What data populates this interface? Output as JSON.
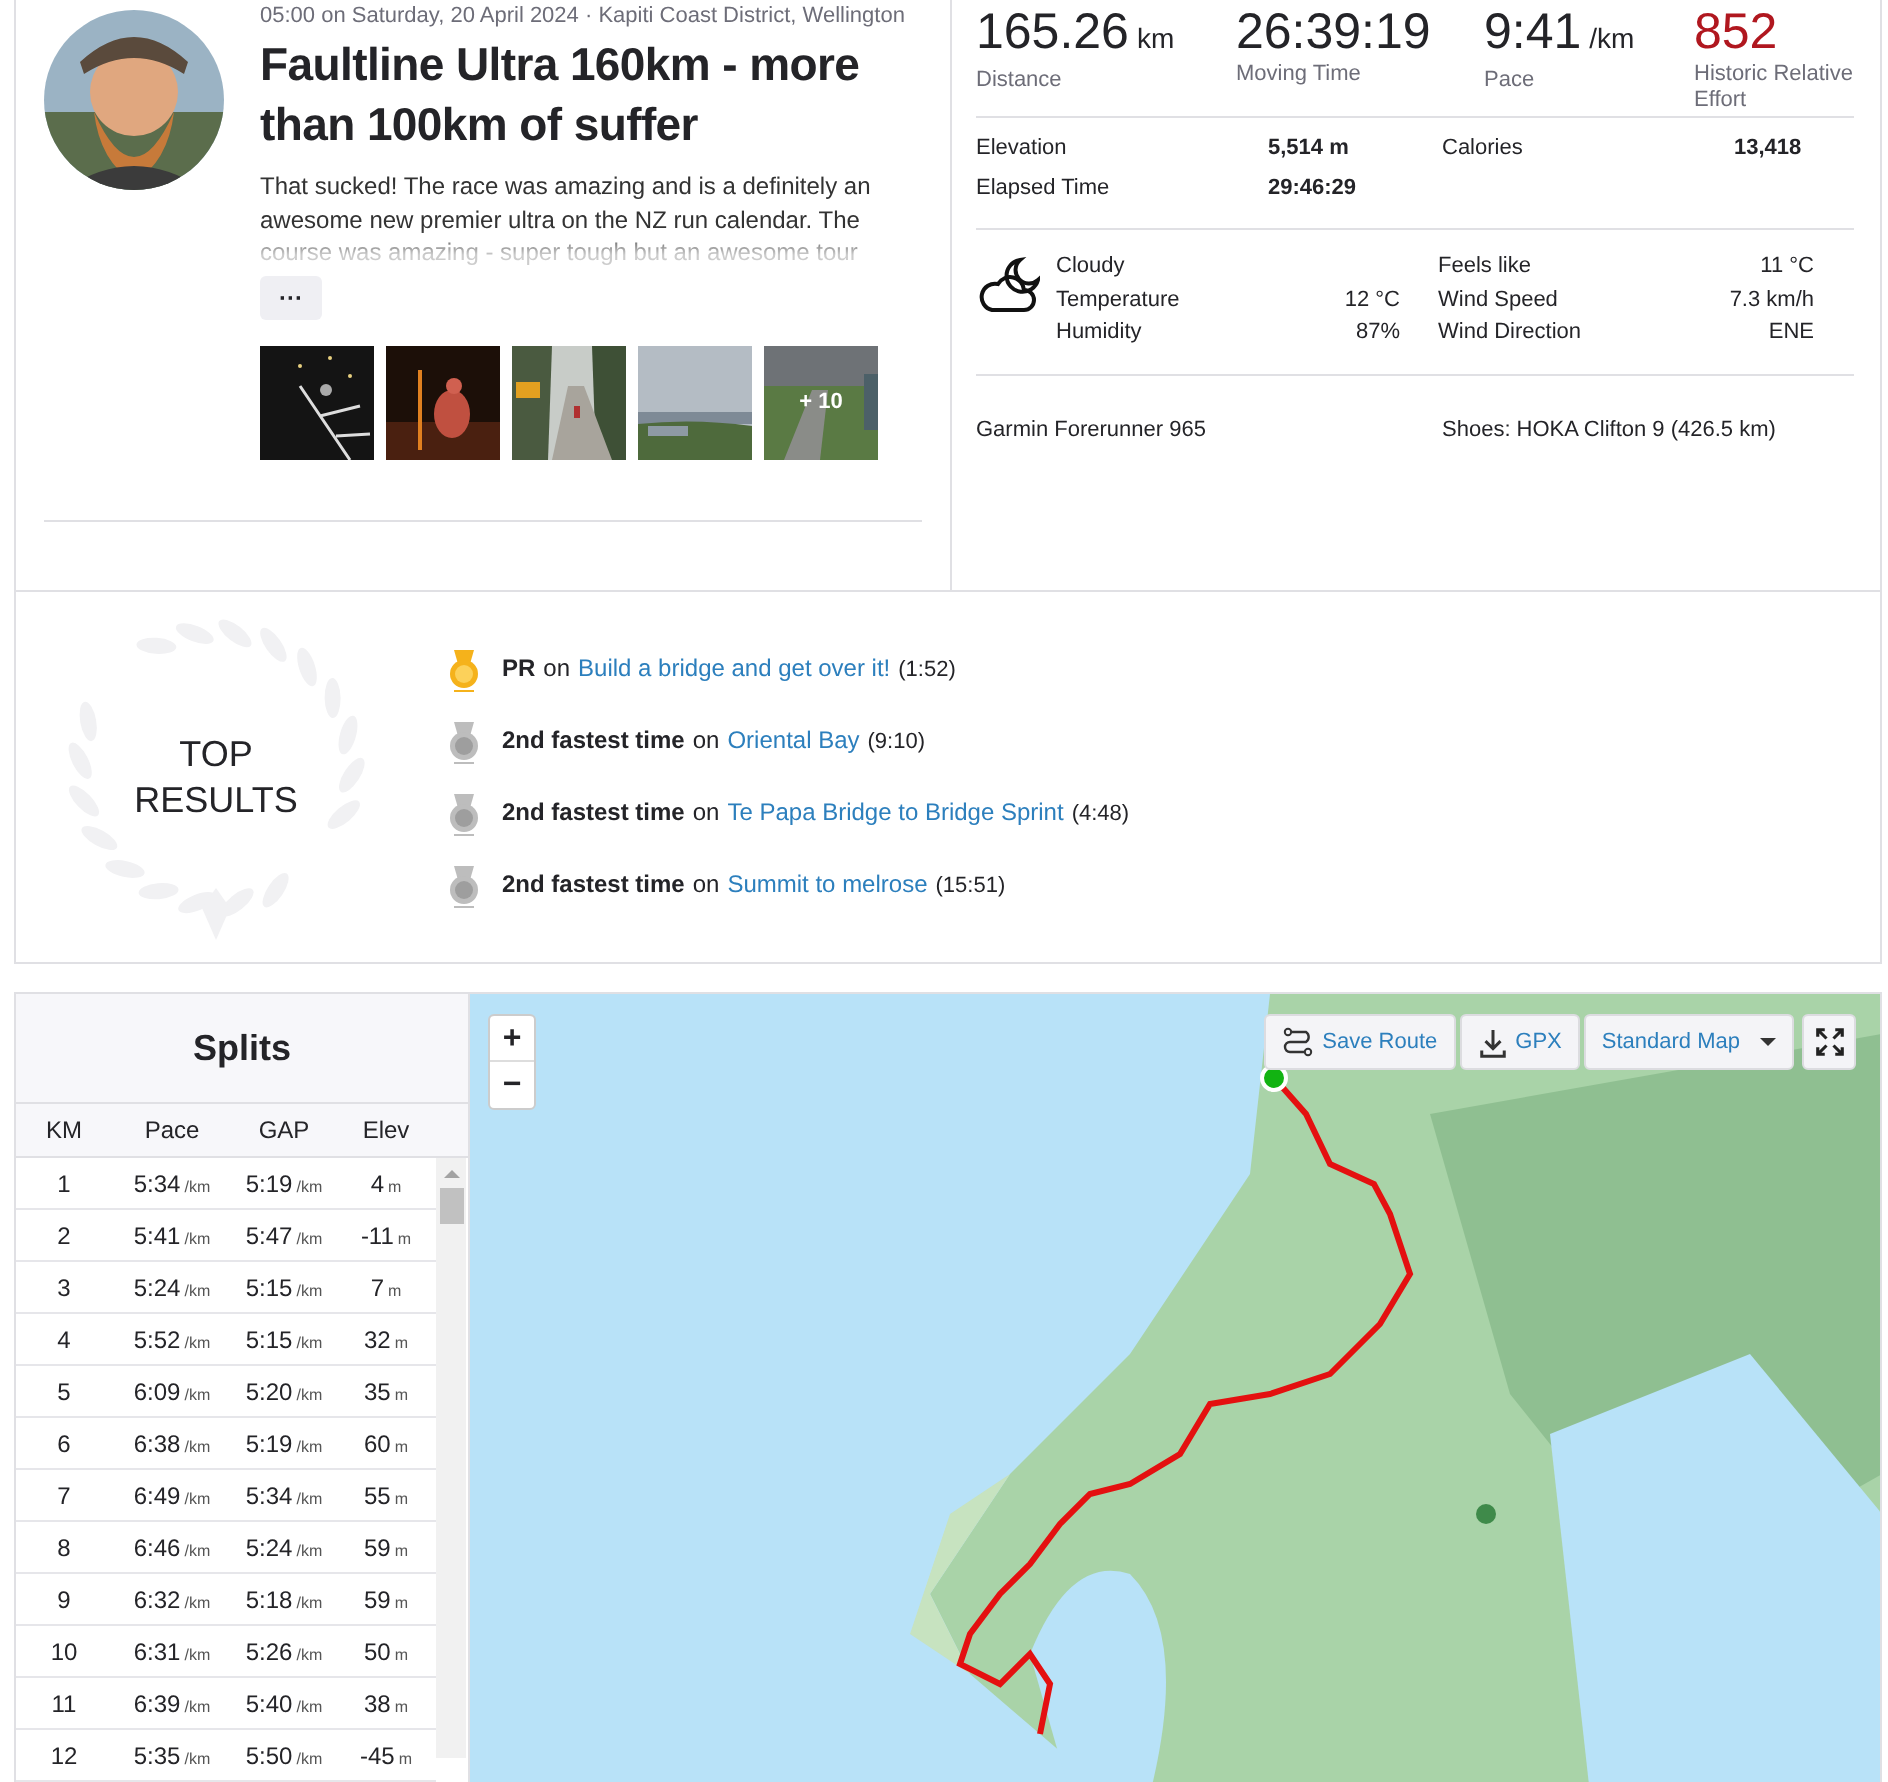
{
  "activity": {
    "date_location": "05:00 on Saturday, 20 April 2024 · Kapiti Coast District, Wellington",
    "title": "Faultline Ultra 160km - more than 100km of suffer",
    "description": "That sucked! The race was amazing and is a definitely an awesome new premier ultra on the NZ run calendar. The course was amazing - super tough but an awesome tour",
    "more_button": "···",
    "more_photos": "+ 10"
  },
  "stats": [
    {
      "value": "165.26",
      "unit": "km",
      "label": "Distance",
      "color": "#242428"
    },
    {
      "value": "26:39:19",
      "label": "Moving Time",
      "color": "#242428"
    },
    {
      "value": "9:41",
      "unit": "/km",
      "label": "Pace",
      "color": "#242428"
    },
    {
      "value": "852",
      "label": "Historic Relative Effort",
      "color": "#b0171f"
    }
  ],
  "details": [
    {
      "label": "Elevation",
      "value": "5,514 m"
    },
    {
      "label": "Calories",
      "value": "13,418"
    },
    {
      "label": "Elapsed Time",
      "value": "29:46:29"
    }
  ],
  "weather": {
    "condition": "Cloudy",
    "left": [
      {
        "label": "Temperature",
        "value": "12 °C"
      },
      {
        "label": "Humidity",
        "value": "87%"
      }
    ],
    "right": [
      {
        "label": "Feels like",
        "value": "11 °C"
      },
      {
        "label": "Wind Speed",
        "value": "7.3 km/h"
      },
      {
        "label": "Wind Direction",
        "value": "ENE"
      }
    ]
  },
  "device": "Garmin Forerunner 965",
  "shoes": "Shoes: HOKA Clifton 9 (426.5 km)",
  "top_results": {
    "heading": "TOP RESULTS",
    "items": [
      {
        "kind": "pr",
        "achievement": "PR",
        "connector": "on",
        "segment": "Build a bridge and get over it!",
        "time": "(1:52)"
      },
      {
        "kind": "second",
        "achievement": "2nd fastest time",
        "connector": "on",
        "segment": "Oriental Bay",
        "time": "(9:10)"
      },
      {
        "kind": "second",
        "achievement": "2nd fastest time",
        "connector": "on",
        "segment": "Te Papa Bridge to Bridge Sprint",
        "time": "(4:48)"
      },
      {
        "kind": "second",
        "achievement": "2nd fastest time",
        "connector": "on",
        "segment": "Summit to melrose",
        "time": "(15:51)"
      }
    ]
  },
  "splits": {
    "title": "Splits",
    "columns": [
      "KM",
      "Pace",
      "GAP",
      "Elev"
    ],
    "rows": [
      {
        "km": "1",
        "pace": "5:34",
        "pace_unit": "/km",
        "gap": "5:19",
        "gap_unit": "/km",
        "elev": "4",
        "elev_unit": "m"
      },
      {
        "km": "2",
        "pace": "5:41",
        "pace_unit": "/km",
        "gap": "5:47",
        "gap_unit": "/km",
        "elev": "-11",
        "elev_unit": "m"
      },
      {
        "km": "3",
        "pace": "5:24",
        "pace_unit": "/km",
        "gap": "5:15",
        "gap_unit": "/km",
        "elev": "7",
        "elev_unit": "m"
      },
      {
        "km": "4",
        "pace": "5:52",
        "pace_unit": "/km",
        "gap": "5:15",
        "gap_unit": "/km",
        "elev": "32",
        "elev_unit": "m"
      },
      {
        "km": "5",
        "pace": "6:09",
        "pace_unit": "/km",
        "gap": "5:20",
        "gap_unit": "/km",
        "elev": "35",
        "elev_unit": "m"
      },
      {
        "km": "6",
        "pace": "6:38",
        "pace_unit": "/km",
        "gap": "5:19",
        "gap_unit": "/km",
        "elev": "60",
        "elev_unit": "m"
      },
      {
        "km": "7",
        "pace": "6:49",
        "pace_unit": "/km",
        "gap": "5:34",
        "gap_unit": "/km",
        "elev": "55",
        "elev_unit": "m"
      },
      {
        "km": "8",
        "pace": "6:46",
        "pace_unit": "/km",
        "gap": "5:24",
        "gap_unit": "/km",
        "elev": "59",
        "elev_unit": "m"
      },
      {
        "km": "9",
        "pace": "6:32",
        "pace_unit": "/km",
        "gap": "5:18",
        "gap_unit": "/km",
        "elev": "59",
        "elev_unit": "m"
      },
      {
        "km": "10",
        "pace": "6:31",
        "pace_unit": "/km",
        "gap": "5:26",
        "gap_unit": "/km",
        "elev": "50",
        "elev_unit": "m"
      },
      {
        "km": "11",
        "pace": "6:39",
        "pace_unit": "/km",
        "gap": "5:40",
        "gap_unit": "/km",
        "elev": "38",
        "elev_unit": "m"
      },
      {
        "km": "12",
        "pace": "5:35",
        "pace_unit": "/km",
        "gap": "5:50",
        "gap_unit": "/km",
        "elev": "-45",
        "elev_unit": "m"
      }
    ]
  },
  "map": {
    "kind": "picture",
    "zoom_in": "+",
    "zoom_out": "−",
    "buttons": [
      {
        "kind": "save",
        "label": "Save Route"
      },
      {
        "kind": "download",
        "label": "GPX"
      },
      {
        "kind": "dropdown",
        "label": "Standard Map"
      }
    ]
  }
}
